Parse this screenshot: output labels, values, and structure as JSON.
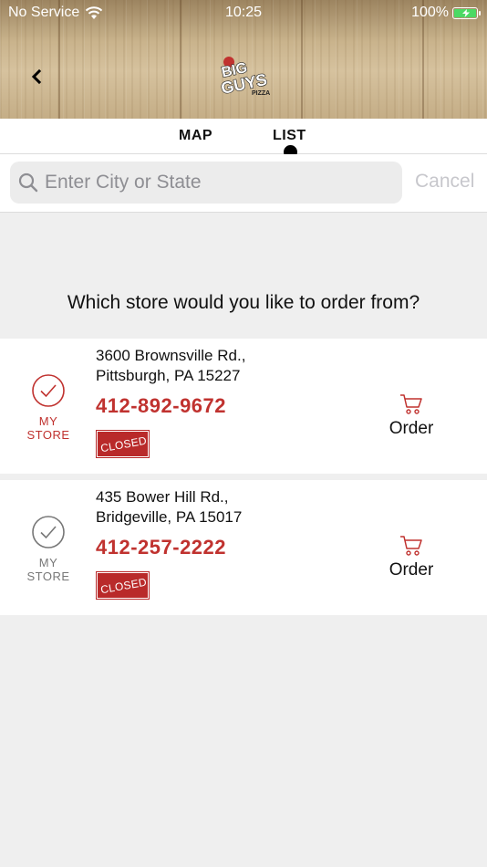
{
  "status_bar": {
    "carrier": "No Service",
    "time": "10:25",
    "battery": "100%",
    "battery_level": 1.0
  },
  "header": {
    "back_icon": "chevron-left-icon",
    "logo": {
      "line1": "BIG",
      "line2": "GUYS",
      "line3": "PIZZA"
    }
  },
  "tabs": {
    "map": "MAP",
    "list": "LIST",
    "selected": "LIST"
  },
  "search": {
    "placeholder": "Enter City or State",
    "value": "",
    "cancel": "Cancel"
  },
  "prompt": "Which store would you like to order from?",
  "stores": [
    {
      "address_line1": "3600 Brownsville Rd.,",
      "address_line2": "Pittsburgh, PA 15227",
      "phone": "412-892-9672",
      "status": "CLOSED",
      "my_store_label": "MY STORE",
      "is_my_store": true,
      "order_label": "Order"
    },
    {
      "address_line1": "435 Bower Hill Rd.,",
      "address_line2": "Bridgeville, PA 15017",
      "phone": "412-257-2222",
      "status": "CLOSED",
      "my_store_label": "MY STORE",
      "is_my_store": false,
      "order_label": "Order"
    }
  ],
  "colors": {
    "accent_red": "#c0322f",
    "closed_badge": "#b92a2a",
    "my_store_selected": "#c0322f",
    "my_store_unselected": "#777777",
    "battery_green": "#4cd964"
  }
}
